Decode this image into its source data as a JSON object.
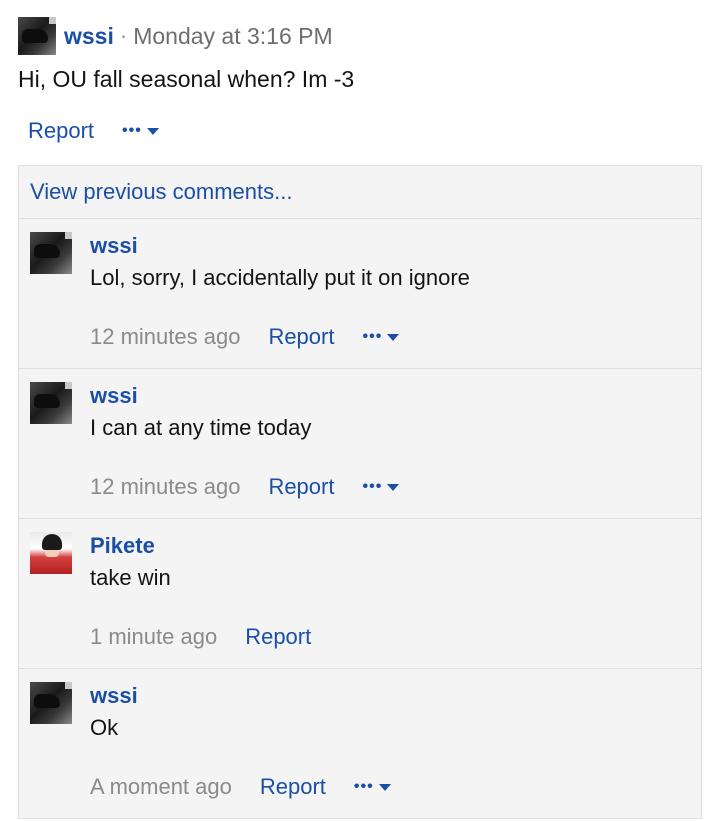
{
  "post": {
    "author": "wssi",
    "separator": "·",
    "timestamp": "Monday at 3:16 PM",
    "body": "Hi, OU fall seasonal when? Im -3",
    "report_label": "Report",
    "more_dots": "•••"
  },
  "comments_section": {
    "view_previous_label": "View previous comments...",
    "items": [
      {
        "author": "wssi",
        "text": "Lol, sorry, I accidentally put it on ignore",
        "time": "12 minutes ago",
        "report_label": "Report",
        "more_dots": "•••"
      },
      {
        "author": "wssi",
        "text": "I can at any time today",
        "time": "12 minutes ago",
        "report_label": "Report",
        "more_dots": "•••"
      },
      {
        "author": "Pikete",
        "text": "take win",
        "time": "1 minute ago",
        "report_label": "Report"
      },
      {
        "author": "wssi",
        "text": "Ok",
        "time": "A moment ago",
        "report_label": "Report",
        "more_dots": "•••"
      }
    ]
  },
  "colors": {
    "link": "#1b4fa6",
    "muted": "#8a8a8a",
    "panel_bg": "#f4f4f4"
  },
  "icons": {
    "more": "more-options-icon",
    "caret": "caret-down-icon"
  }
}
